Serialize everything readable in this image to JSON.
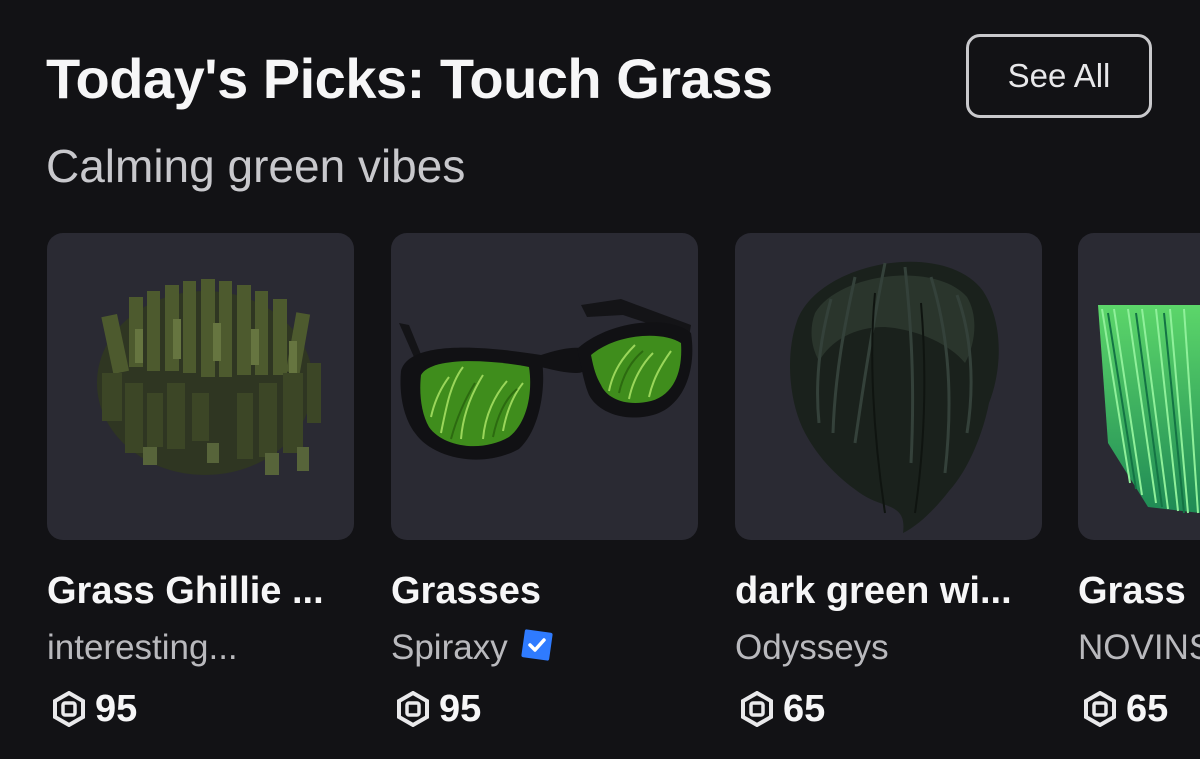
{
  "section": {
    "title": "Today's Picks: Touch Grass",
    "subtitle": "Calming green vibes",
    "see_all_label": "See All"
  },
  "items": [
    {
      "name": "Grass Ghillie ...",
      "creator": "interesting...",
      "verified": false,
      "price": "95",
      "thumb_icon": "grass-ghillie-hair-icon"
    },
    {
      "name": "Grasses",
      "creator": "Spiraxy",
      "verified": true,
      "price": "95",
      "thumb_icon": "grass-sunglasses-icon"
    },
    {
      "name": "dark green wi...",
      "creator": "Odysseys",
      "verified": false,
      "price": "65",
      "thumb_icon": "dark-green-hair-icon"
    },
    {
      "name": "Grass",
      "creator": "NOVINS",
      "verified": false,
      "price": "65",
      "thumb_icon": "green-grass-hair-icon"
    }
  ],
  "icons": {
    "currency": "robux-icon",
    "verified": "verified-badge-icon"
  },
  "colors": {
    "background": "#121215",
    "card_thumb_bg": "#2a2a33",
    "verified_badge": "#2f7bff"
  }
}
